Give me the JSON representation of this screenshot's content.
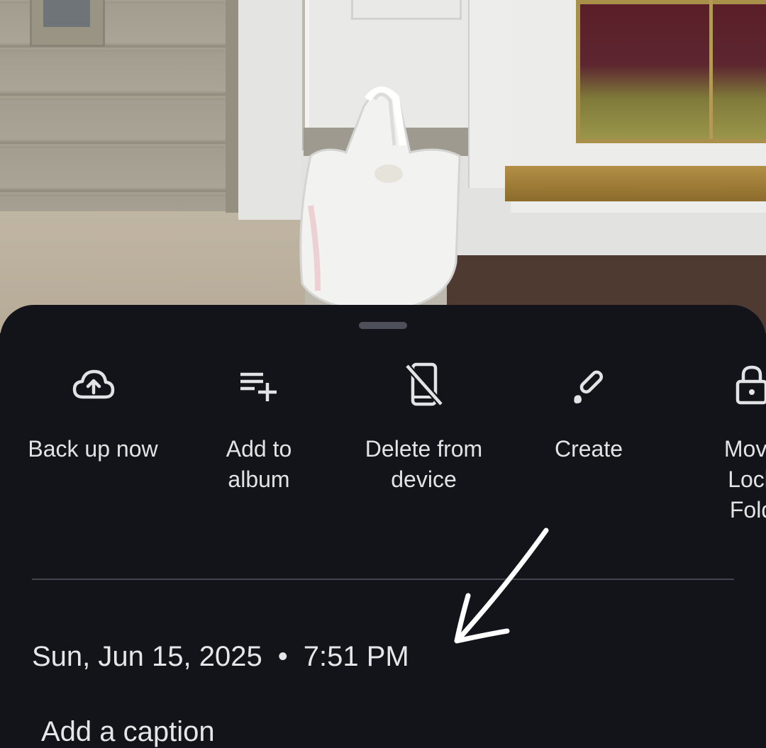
{
  "actions": [
    {
      "label": "Back up now",
      "icon": "cloud-upload-icon"
    },
    {
      "label": "Add to\nalbum",
      "icon": "playlist-add-icon"
    },
    {
      "label": "Delete from\ndevice",
      "icon": "phone-delete-icon"
    },
    {
      "label": "Create",
      "icon": "brush-icon"
    },
    {
      "label": "Move\nLock\nFold",
      "icon": "lock-icon"
    }
  ],
  "details": {
    "date": "Sun, Jun 15, 2025",
    "separator": "•",
    "time": "7:51 PM",
    "caption": "Add a caption"
  },
  "colors": {
    "sheet_background": "#13141a",
    "text": "#e3e3e6",
    "divider": "#42454d",
    "annotation": "#ffffff"
  }
}
